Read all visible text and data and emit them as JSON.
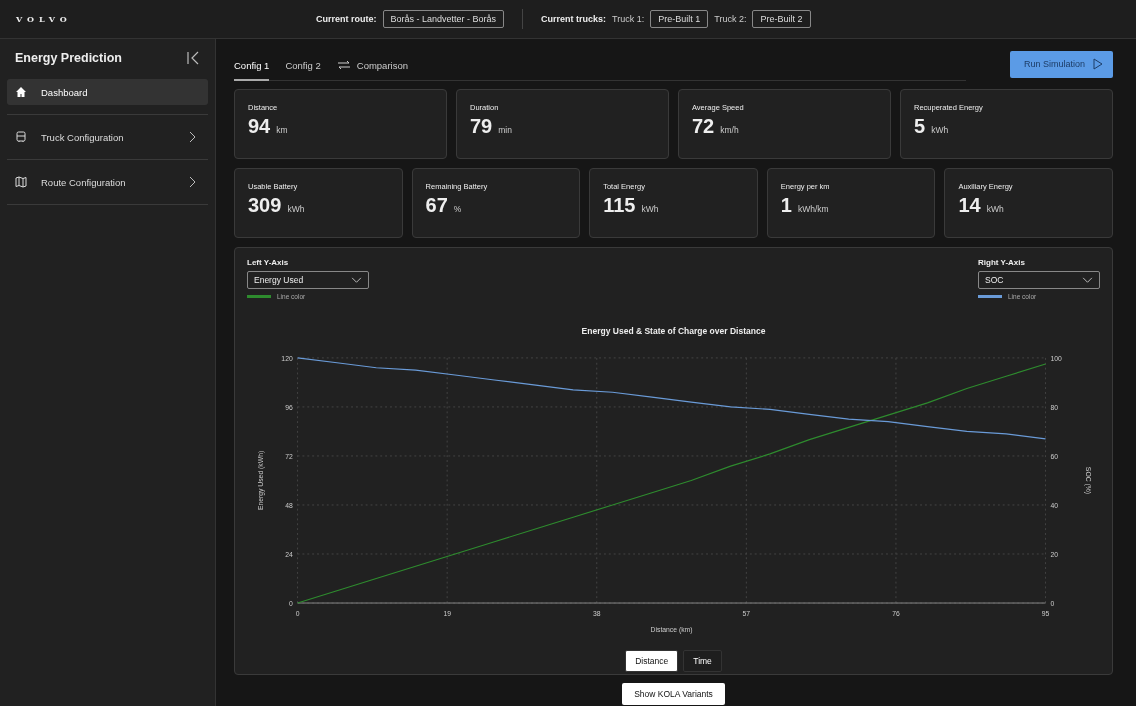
{
  "header": {
    "logo": "VOLVO",
    "route_label": "Current route:",
    "route": "Borås - Landvetter - Borås",
    "trucks_label": "Current trucks:",
    "trucks": [
      {
        "label": "Truck 1:",
        "value": "Pre-Built 1"
      },
      {
        "label": "Truck 2:",
        "value": "Pre-Built 2"
      }
    ]
  },
  "sidebar": {
    "title": "Energy Prediction",
    "items": [
      {
        "label": "Dashboard",
        "selected": true,
        "has_arrow": false
      },
      {
        "label": "Truck Configuration",
        "selected": false,
        "has_arrow": true
      },
      {
        "label": "Route Configuration",
        "selected": false,
        "has_arrow": true
      }
    ]
  },
  "tabs": [
    {
      "label": "Config 1",
      "selected": true,
      "icon": false
    },
    {
      "label": "Config 2",
      "selected": false,
      "icon": false
    },
    {
      "label": "Comparison",
      "selected": false,
      "icon": true
    }
  ],
  "run_button": "Run Simulation",
  "stats_row_1": [
    {
      "label": "Distance",
      "value": "94",
      "unit": "km"
    },
    {
      "label": "Duration",
      "value": "79",
      "unit": "min"
    },
    {
      "label": "Average Speed",
      "value": "72",
      "unit": "km/h"
    },
    {
      "label": "Recuperated Energy",
      "value": "5",
      "unit": "kWh"
    }
  ],
  "stats_row_2": [
    {
      "label": "Usable Battery",
      "value": "309",
      "unit": "kWh"
    },
    {
      "label": "Remaining Battery",
      "value": "67",
      "unit": "%"
    },
    {
      "label": "Total Energy",
      "value": "115",
      "unit": "kWh"
    },
    {
      "label": "Energy per km",
      "value": "1",
      "unit": "kWh/km"
    },
    {
      "label": "Auxiliary Energy",
      "value": "14",
      "unit": "kWh"
    }
  ],
  "left_axis": {
    "label": "Left Y-Axis",
    "legend": "Line color"
  },
  "right_axis": {
    "label": "Right Y-Axis",
    "legend": "Line color"
  },
  "chart_data": {
    "type": "line",
    "grid": true,
    "title": "Energy Used & State of Charge over Distance",
    "xlabel": "Distance (km)",
    "ylabel": "Energy Used (kWh)",
    "y2label": "SOC (%)",
    "x": [
      0,
      5,
      10,
      15,
      20,
      25,
      30,
      35,
      40,
      45,
      50,
      55,
      60,
      65,
      70,
      75,
      80,
      85,
      90,
      95
    ],
    "xlim": [
      0,
      95
    ],
    "ylim": [
      0,
      120
    ],
    "y2lim": [
      0,
      100
    ],
    "xticks": [
      0,
      19,
      38,
      57,
      76,
      95
    ],
    "yticks": [
      0,
      24,
      48,
      72,
      96,
      120
    ],
    "y2ticks": [
      0,
      20,
      40,
      60,
      80,
      100
    ],
    "series": [
      {
        "name": "Energy Used",
        "color": "#2e8b2e",
        "values": [
          0,
          6,
          12,
          18,
          24,
          30,
          36,
          42,
          48,
          54,
          60,
          67,
          73,
          80,
          86,
          92,
          98,
          105,
          111,
          117
        ]
      },
      {
        "name": "SOC",
        "color": "#6a9bd8",
        "axis": "y2",
        "values": [
          100,
          98,
          96,
          95,
          93,
          91,
          89,
          87,
          86,
          84,
          82,
          80,
          79,
          77,
          75,
          74,
          72,
          70,
          69,
          67
        ]
      }
    ]
  },
  "x_modes": [
    {
      "label": "Distance",
      "selected": true
    },
    {
      "label": "Time",
      "selected": false
    }
  ],
  "kola_button": "Show KOLA Variants"
}
